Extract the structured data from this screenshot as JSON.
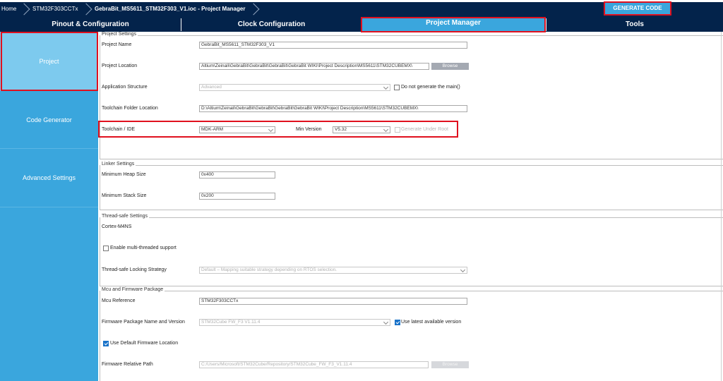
{
  "breadcrumb": {
    "home": "Home",
    "mcu": "STM32F303CCTx",
    "project": "GebraBit_MS5611_STM32F303_V1.ioc - Project Manager"
  },
  "generate_button": "GENERATE CODE",
  "tabs": [
    "Pinout & Configuration",
    "Clock Configuration",
    "Project Manager",
    "Tools"
  ],
  "active_tab": "Project Manager",
  "sidebar": {
    "items": [
      {
        "label": "Project",
        "active": true
      },
      {
        "label": "Code Generator",
        "active": false
      },
      {
        "label": "Advanced Settings",
        "active": false
      }
    ]
  },
  "project_settings": {
    "title": "Project Settings",
    "project_name_label": "Project Name",
    "project_name": "GebraBit_MS5611_STM32F303_V1",
    "project_location_label": "Project Location",
    "project_location": "Altium\\Zeinali\\GebraBit\\GebraBit\\GebraBit\\GebraBit WIKI\\Project Description\\MS5611\\STM32CUBEMX\\",
    "browse": "Browse",
    "app_structure_label": "Application Structure",
    "app_structure": "Advanced",
    "no_main_label": "Do not generate the main()",
    "toolchain_folder_label": "Toolchain Folder Location",
    "toolchain_folder": "D:\\Altium\\Zeinali\\GebraBit\\GebraBit\\GebraBit\\GebraBit WIKI\\Project Description\\MS5611\\STM32CUBEMX\\",
    "toolchain_label": "Toolchain / IDE",
    "toolchain": "MDK-ARM",
    "min_version_label": "Min Version",
    "min_version": "V5.32",
    "generate_under_root": "Generate Under Root"
  },
  "linker_settings": {
    "title": "Linker Settings",
    "heap_label": "Minimum Heap Size",
    "heap": "0x400",
    "stack_label": "Minimum Stack Size",
    "stack": "0x200"
  },
  "thread_safe": {
    "title": "Thread-safe Settings",
    "core": "Cortex-M4NS",
    "multithread_label": "Enable multi-threaded support",
    "locking_label": "Thread-safe Locking Strategy",
    "locking": "Default – Mapping suitable strategy depending on RTOS selection."
  },
  "mcu_package": {
    "title": "Mcu and Firmware Package",
    "mcu_ref_label": "Mcu Reference",
    "mcu_ref": "STM32F303CCTx",
    "fw_label": "Firmware Package Name and Version",
    "fw": "STM32Cube FW_F3 V1.11.4",
    "use_latest_label": "Use latest available version",
    "default_location_label": "Use Default Firmware Location",
    "fw_path_label": "Firmware Relative Path",
    "fw_path": "C:/Users/Microsoft/STM32Cube/Repository/STM32Cube_FW_F3_V1.11.4",
    "browse": "Browse"
  },
  "colors": {
    "navy": "#03234b",
    "accent": "#3aa6dd",
    "highlight": "#e0101e"
  }
}
